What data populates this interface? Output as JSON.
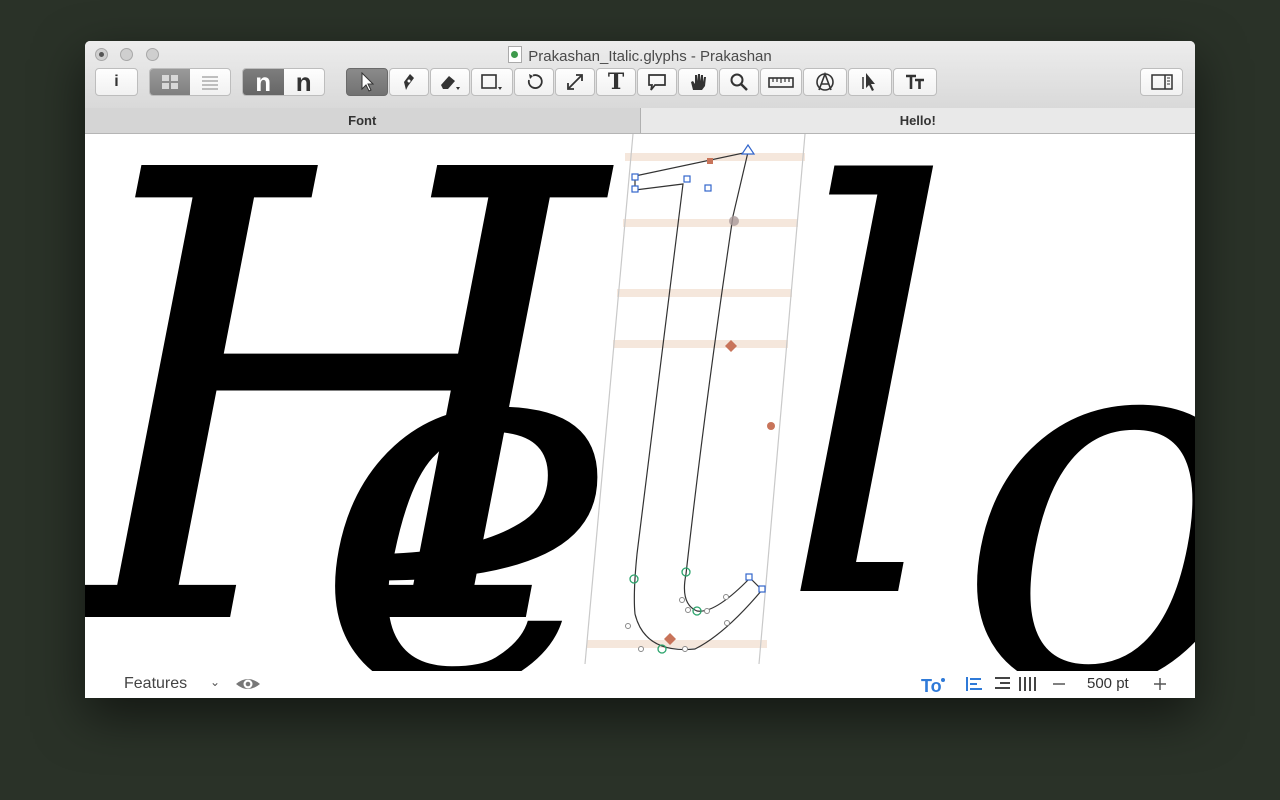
{
  "window": {
    "title": "Prakashan_Italic.glyphs - Prakashan"
  },
  "toolbar": {
    "info_label": "i",
    "glyph_n_label": "n",
    "text_tool_label": "T"
  },
  "tabs": [
    {
      "label": "Font",
      "active": false
    },
    {
      "label": "Hello!",
      "active": true
    }
  ],
  "canvas": {
    "glyphs": [
      "H",
      "e",
      "l",
      "o"
    ]
  },
  "statusbar": {
    "features_label": "Features",
    "font_size": "500 pt"
  },
  "colors": {
    "node_blue": "#3366cc",
    "node_green": "#2aa36b",
    "anchor_orange": "#c8745a",
    "metric_band": "#f5e7dc"
  }
}
